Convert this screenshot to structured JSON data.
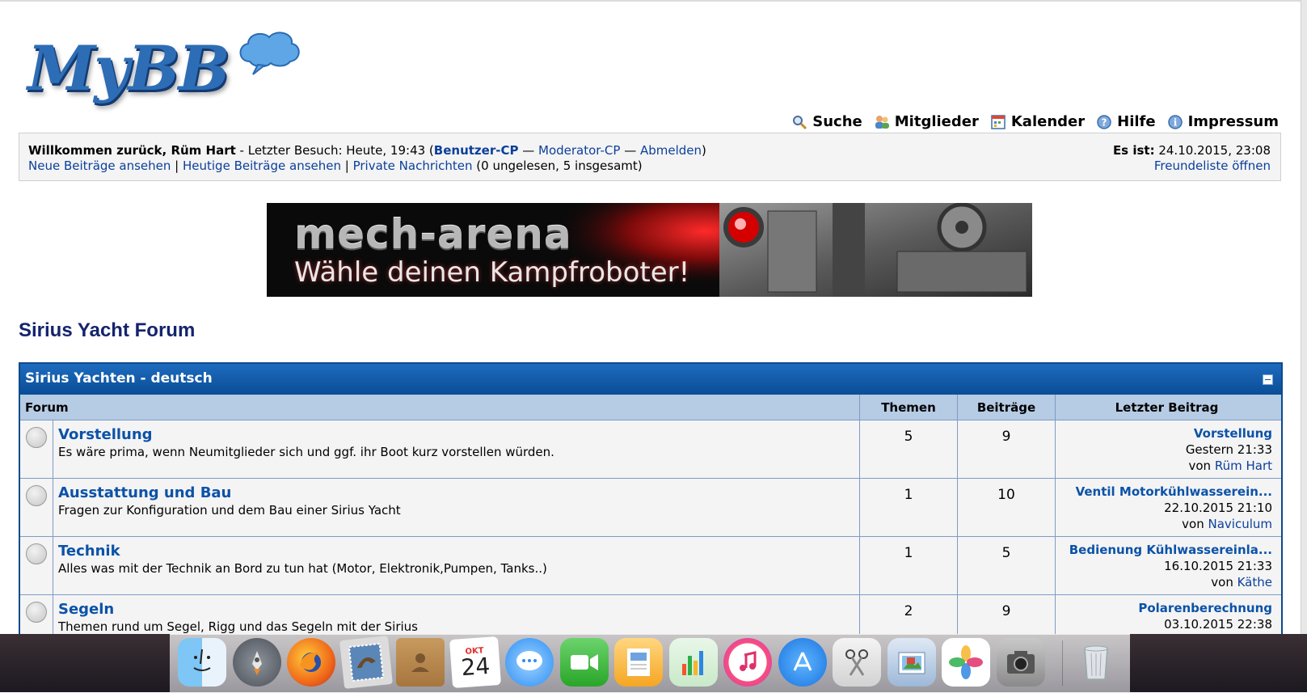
{
  "logo": {
    "text": "MyBB"
  },
  "top_menu": [
    {
      "label": "Suche",
      "icon": "search-icon"
    },
    {
      "label": "Mitglieder",
      "icon": "members-icon"
    },
    {
      "label": "Kalender",
      "icon": "calendar-icon"
    },
    {
      "label": "Hilfe",
      "icon": "help-icon"
    },
    {
      "label": "Impressum",
      "icon": "info-icon"
    }
  ],
  "welcome": {
    "greeting": "Willkommen zurück, Rüm Hart",
    "last_visit": " - Letzter Besuch: Heute, 19:43 (",
    "user_cp": "Benutzer-CP",
    "sep": " — ",
    "mod_cp": "Moderator-CP",
    "logout": "Abmelden",
    "close": ")",
    "new_posts": "Neue Beiträge ansehen",
    "today_posts": "Heutige Beiträge ansehen",
    "pipe": " | ",
    "pm": "Private Nachrichten",
    "pm_status": " (0 ungelesen, 5 insgesamt)",
    "time_label": "Es ist:",
    "time_value": " 24.10.2015, 23:08",
    "buddy_list": "Freundeliste öffnen"
  },
  "banner": {
    "title": "mech-arena",
    "subtitle": "Wähle deinen Kampfroboter!"
  },
  "forum_title": "Sirius Yacht Forum",
  "category": {
    "title": "Sirius Yachten - deutsch",
    "columns": {
      "forum": "Forum",
      "topics": "Themen",
      "posts": "Beiträge",
      "last_post": "Letzter Beitrag"
    },
    "forums": [
      {
        "name": "Vorstellung",
        "description": "Es wäre prima, wenn Neumitglieder sich und ggf. ihr Boot kurz vorstellen würden.",
        "topics": "5",
        "posts": "9",
        "last_title": "Vorstellung",
        "last_date": "Gestern 21:33",
        "by": "von ",
        "last_user": "Rüm Hart"
      },
      {
        "name": "Ausstattung und Bau",
        "description": "Fragen zur Konfiguration und dem Bau einer Sirius Yacht",
        "topics": "1",
        "posts": "10",
        "last_title": "Ventil Motorkühlwasserein...",
        "last_date": "22.10.2015 21:10",
        "by": "von ",
        "last_user": "Naviculum"
      },
      {
        "name": "Technik",
        "description": "Alles was mit der Technik an Bord zu tun hat (Motor, Elektronik,Pumpen, Tanks..)",
        "topics": "1",
        "posts": "5",
        "last_title": "Bedienung Kühlwassereinla...",
        "last_date": "16.10.2015 21:33",
        "by": "von ",
        "last_user": "Käthe"
      },
      {
        "name": "Segeln",
        "description": "Themen rund um Segel, Rigg und das Segeln mit der Sirius",
        "topics": "2",
        "posts": "9",
        "last_title": "Polarenberechnung",
        "last_date": "03.10.2015 22:38",
        "by": "",
        "last_user": ""
      }
    ]
  },
  "dock": {
    "calendar_month": "OKT",
    "calendar_day": "24",
    "apps": [
      "finder-icon",
      "launchpad-icon",
      "firefox-icon",
      "mail-icon",
      "contacts-icon",
      "calendar-icon",
      "messages-icon",
      "facetime-icon",
      "pages-icon",
      "numbers-icon",
      "itunes-icon",
      "app-store-icon",
      "scissors-icon",
      "preview-icon",
      "photos-icon",
      "screenshot-icon",
      "trash-icon"
    ]
  },
  "colors": {
    "link": "#0b3f9b",
    "header_blue": "#0a4d96",
    "colhead": "#b6cbe4",
    "title": "#14236e"
  }
}
